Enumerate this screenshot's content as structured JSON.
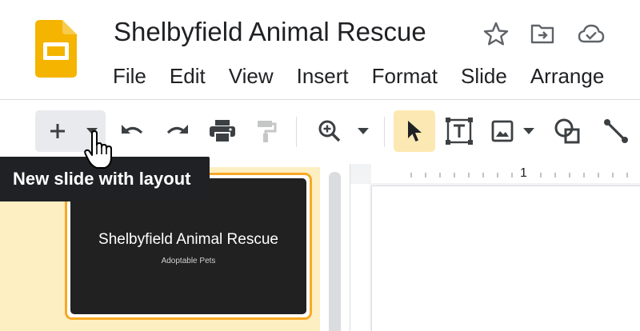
{
  "app": {
    "doc_title": "Shelbyfield Animal Rescue",
    "logo_icon": "google-slides-logo",
    "brand_color": "#f4b400"
  },
  "header_icons": [
    "star-icon",
    "move-to-folder-icon",
    "cloud-saved-icon"
  ],
  "menu": [
    "File",
    "Edit",
    "View",
    "Insert",
    "Format",
    "Slide",
    "Arrange"
  ],
  "toolbar": {
    "buttons": [
      "new-slide",
      "new-slide-layout-dropdown",
      "undo",
      "redo",
      "print",
      "paint-format",
      "zoom",
      "zoom-dropdown",
      "select",
      "text-box",
      "insert-image",
      "image-dropdown",
      "shape",
      "line"
    ],
    "active_tool": "select",
    "active_color": "#fce8b2"
  },
  "tooltip": {
    "text": "New slide with layout"
  },
  "ruler": {
    "label": "1"
  },
  "filmstrip": {
    "selected_color": "#f9a825",
    "slides": [
      {
        "title": "Shelbyfield Animal Rescue",
        "subtitle": "Adoptable Pets"
      }
    ]
  }
}
